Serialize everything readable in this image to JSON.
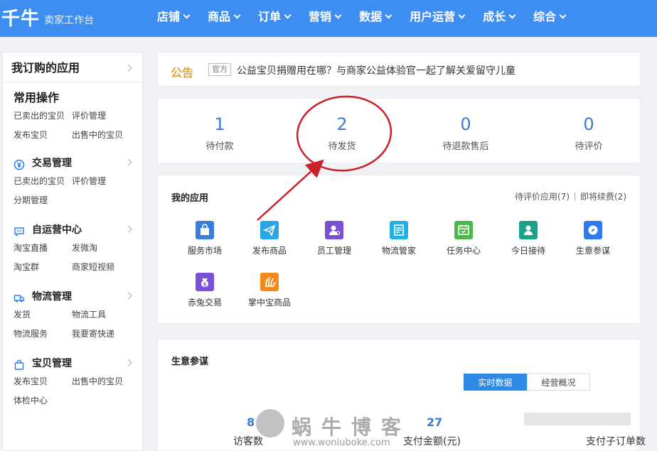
{
  "header": {
    "logo": "千牛",
    "subtitle": "卖家工作台",
    "nav": [
      "店铺",
      "商品",
      "订单",
      "营销",
      "数据",
      "用户运营",
      "成长",
      "综合"
    ]
  },
  "sidebar": {
    "title": "我订购的应用",
    "common": {
      "title": "常用操作",
      "links": [
        "已卖出的宝贝",
        "评价管理",
        "发布宝贝",
        "出售中的宝贝"
      ]
    },
    "sections": [
      {
        "icon": "yen-icon",
        "title": "交易管理",
        "links": [
          "已卖出的宝贝",
          "评价管理",
          "分期管理"
        ]
      },
      {
        "icon": "chat-icon",
        "title": "自运营中心",
        "links": [
          "淘宝直播",
          "发微淘",
          "淘宝群",
          "商家短视频"
        ]
      },
      {
        "icon": "truck-icon",
        "title": "物流管理",
        "links": [
          "发货",
          "物流工具",
          "物流服务",
          "我要寄快递"
        ]
      },
      {
        "icon": "bag-icon",
        "title": "宝贝管理",
        "links": [
          "发布宝贝",
          "出售中的宝贝",
          "体检中心"
        ]
      }
    ]
  },
  "notice": {
    "label": "公告",
    "tag": "官方",
    "text": "公益宝贝捐赠用在哪？与商家公益体验官一起了解关爱留守儿童"
  },
  "stats": [
    {
      "value": "1",
      "label": "待付款"
    },
    {
      "value": "2",
      "label": "待发货"
    },
    {
      "value": "0",
      "label": "待退款售后"
    },
    {
      "value": "0",
      "label": "待评价"
    }
  ],
  "apps": {
    "title": "我的应用",
    "pending_review": "待评价应用(7)",
    "renewal": "即将续费(2)",
    "items": [
      {
        "label": "服务市场",
        "icon": "shopping-bag-icon",
        "color": "#3b7ddd"
      },
      {
        "label": "发布商品",
        "icon": "paper-plane-icon",
        "color": "#2aa5e8"
      },
      {
        "label": "员工管理",
        "icon": "user-icon",
        "color": "#7a4fd1"
      },
      {
        "label": "物流管家",
        "icon": "logistics-icon",
        "color": "#22b0e3"
      },
      {
        "label": "任务中心",
        "icon": "calendar-icon",
        "color": "#4bb84b"
      },
      {
        "label": "今日接待",
        "icon": "reception-icon",
        "color": "#1aa386"
      },
      {
        "label": "生意参谋",
        "icon": "compass-icon",
        "color": "#2e7bf0"
      },
      {
        "label": "赤兔交易",
        "icon": "money-bag-icon",
        "color": "#7b4fd8"
      },
      {
        "label": "掌中宝商品",
        "icon": "palm-icon",
        "color": "#f28a1a"
      }
    ]
  },
  "business": {
    "title": "生意参谋",
    "tabs": [
      "实时数据",
      "经营概况"
    ],
    "active_tab": "实时数据",
    "metrics": [
      {
        "value": "8",
        "label": "访客数"
      },
      {
        "value": "27",
        "label": "支付金额(元)"
      },
      {
        "value": "",
        "label": "支付子订单数"
      }
    ]
  },
  "watermark": {
    "text": "蜗牛博客",
    "url": "www.woniuboke.com"
  },
  "annotation": {
    "stroke_color": "#c8232b"
  }
}
